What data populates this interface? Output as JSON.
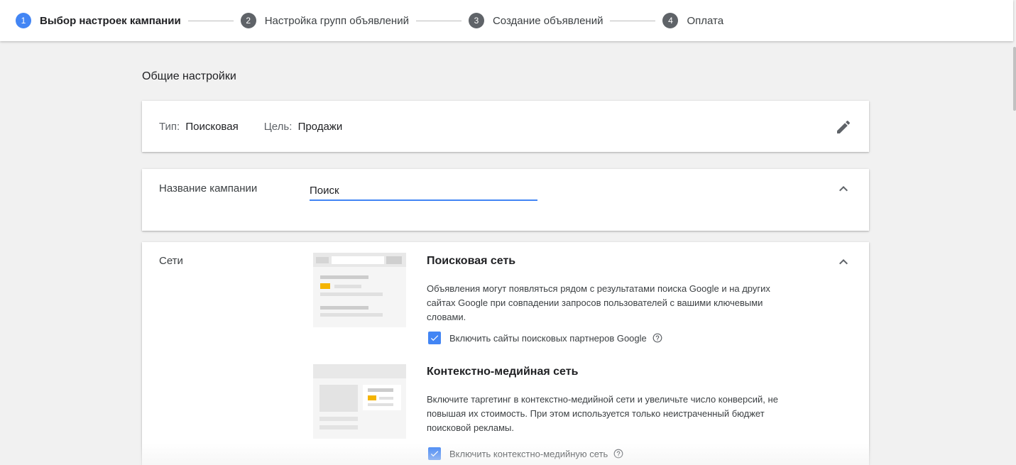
{
  "stepper": {
    "steps": [
      {
        "num": "1",
        "label": "Выбор настроек кампании"
      },
      {
        "num": "2",
        "label": "Настройка групп объявлений"
      },
      {
        "num": "3",
        "label": "Создание объявлений"
      },
      {
        "num": "4",
        "label": "Оплата"
      }
    ],
    "active_step": 1,
    "accent_color": "#4285f4"
  },
  "section": {
    "title": "Общие настройки"
  },
  "general": {
    "type_key": "Тип:",
    "type_value": "Поисковая",
    "goal_key": "Цель:",
    "goal_value": "Продажи",
    "edit_icon": "pencil-icon"
  },
  "campaign_name": {
    "label": "Название кампании",
    "value": "Поиск",
    "collapse_icon": "chevron-up-icon"
  },
  "networks": {
    "label": "Сети",
    "collapse_icon": "chevron-up-icon",
    "search": {
      "title": "Поисковая сеть",
      "description": "Объявления могут появляться рядом с результатами поиска Google и на других сайтах Google при совпадении запросов пользователей с вашими ключевыми словами.",
      "checkbox_label": "Включить сайты поисковых партнеров Google",
      "checked": true
    },
    "display": {
      "title": "Контекстно-медийная сеть",
      "description": "Включите таргетинг в контекстно-медийной сети и увеличьте число конверсий, не повышая их стоимость. При этом используется только неистраченный бюджет поисковой рекламы.",
      "checkbox_label": "Включить контекстно-медийную сеть",
      "checked": true
    }
  }
}
